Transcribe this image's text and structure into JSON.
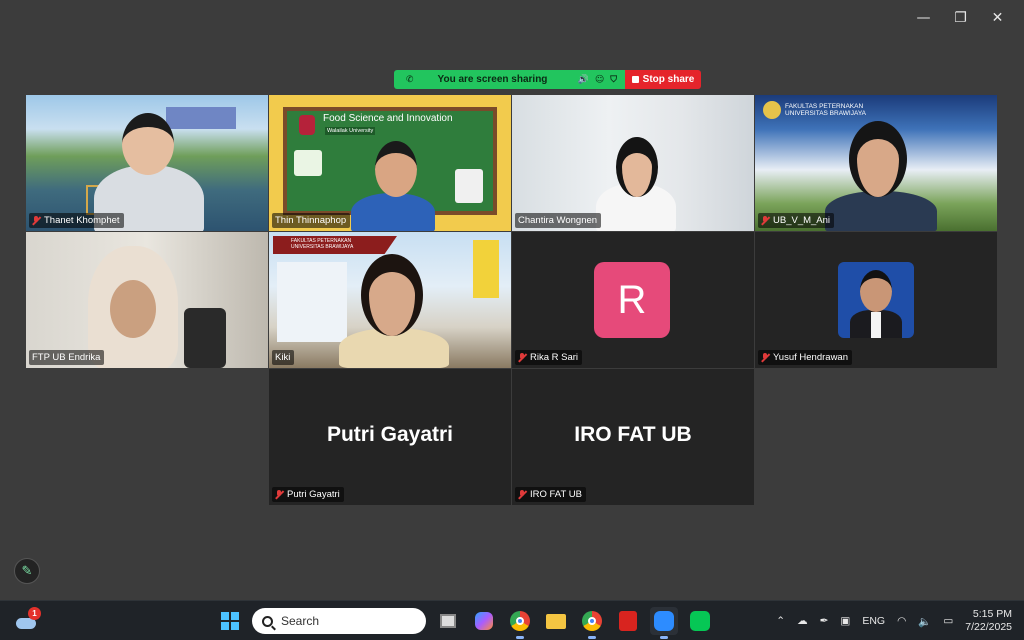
{
  "window_controls": {
    "minimize": "—",
    "restore": "❐",
    "close": "✕"
  },
  "share_bar": {
    "message": "You are screen sharing",
    "stop_label": "Stop share"
  },
  "participants": [
    {
      "name": "Thanet Khomphet"
    },
    {
      "name": "Thin Thinnaphop",
      "slide_title": "Food Science and Innovation",
      "slide_sub": "Walailak University"
    },
    {
      "name": "Chantira Wongnen"
    },
    {
      "name": "UB_V_M_Ani",
      "banner": "FAKULTAS PETERNAKAN UNIVERSITAS BRAWIJAYA"
    },
    {
      "name": "FTP UB Endrika"
    },
    {
      "name": "Kiki",
      "banner": "FAKULTAS PETERNAKAN UNIVERSITAS BRAWIJAYA"
    },
    {
      "name": "Rika R Sari",
      "initial": "R"
    },
    {
      "name": "Yusuf Hendrawan"
    },
    {
      "name": "Putri Gayatri",
      "display": "Putri Gayatri"
    },
    {
      "name": "IRO FAT UB",
      "display": "IRO FAT UB"
    }
  ],
  "taskbar": {
    "weather_badge": "1",
    "search_placeholder": "Search",
    "language": "ENG",
    "time": "5:15 PM",
    "date": "7/22/2025"
  }
}
